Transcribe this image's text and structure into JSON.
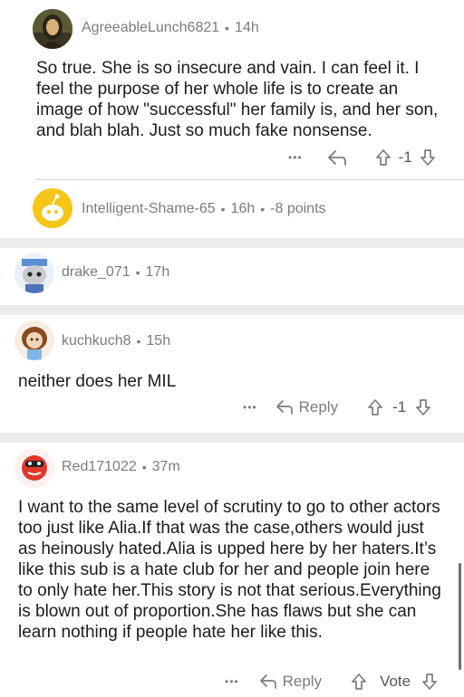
{
  "comments": [
    {
      "username": "AgreeableLunch6821",
      "time": "14h",
      "body": "So true. She is so insecure and vain. I can feel it. I feel the purpose of her whole life is to create an image of how \"successful\" her family is, and her son, and blah blah. Just so much fake nonsense.",
      "more": "•••",
      "vote_count": "-1"
    },
    {
      "username": "Intelligent-Shame-65",
      "time": "16h",
      "points": "-8 points"
    },
    {
      "username": "drake_071",
      "time": "17h"
    },
    {
      "username": "kuchkuch8",
      "time": "15h",
      "body": "neither does her MIL",
      "more": "•••",
      "reply_label": "Reply",
      "vote_count": "-1"
    },
    {
      "username": "Red171022",
      "time": "37m",
      "body": "I want to the same level of scrutiny to go to other actors too just like Alia.If that was the case,others would just as heinously hated.Alia is upped here by her haters.It’s like this sub is a hate club for her and people join here to only hate her.This story is not that serious.Everything is blown out of proportion.She has flaws but she can learn nothing if people hate her like this.",
      "more": "•••",
      "reply_label": "Reply",
      "vote_label": "Vote"
    }
  ],
  "separator": "•",
  "colors": {
    "meta_gray": "#7c7c7c",
    "divider": "#ececec",
    "snoo_yellow": "#f5c518",
    "red_avatar": "#e0372a"
  }
}
